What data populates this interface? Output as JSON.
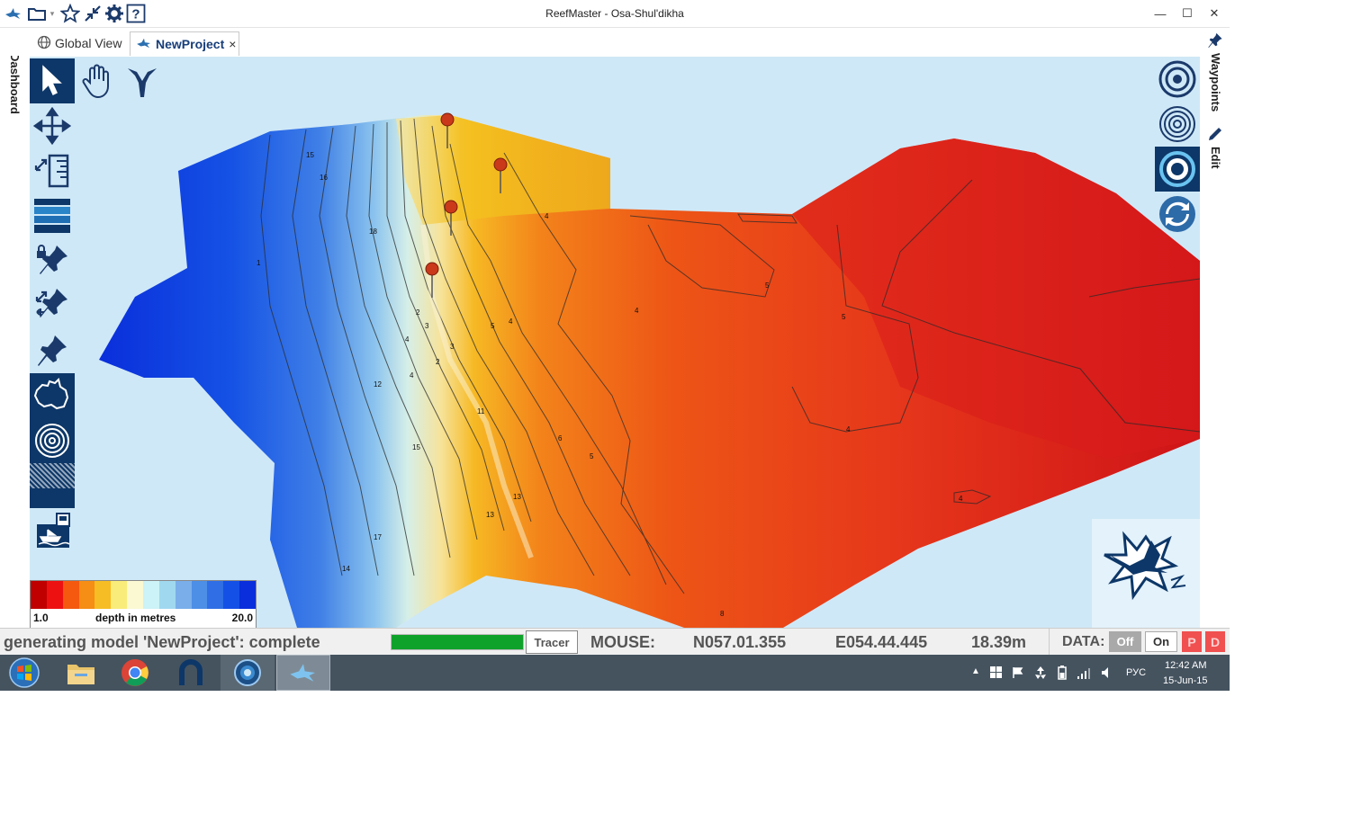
{
  "window": {
    "title": "ReefMaster - Osa-Shul'dikha"
  },
  "tabs": [
    {
      "label": "Global View"
    },
    {
      "label": "NewProject",
      "close": "×"
    }
  ],
  "side_panels": {
    "left": "Dashboard",
    "right_top": "Waypoints",
    "right_bottom": "Edit"
  },
  "legend": {
    "min": "1.0",
    "label": "depth in metres",
    "max": "20.0",
    "colors": [
      "#c00000",
      "#ee1111",
      "#f4590f",
      "#f68d14",
      "#f7bd24",
      "#faec7a",
      "#fbf9d2",
      "#ccf3f7",
      "#a0d8f0",
      "#79aeea",
      "#4d8fe6",
      "#2f6ee5",
      "#1550e6",
      "#0a2edb"
    ]
  },
  "contour_labels": [
    "15",
    "16",
    "18",
    "4",
    "4",
    "5",
    "4",
    "3",
    "2",
    "6",
    "4",
    "5",
    "5",
    "12",
    "17",
    "15",
    "13",
    "13",
    "14",
    "4",
    "1",
    "2",
    "3",
    "4",
    "8",
    "11",
    "5",
    "4"
  ],
  "status": {
    "message": "generating model 'NewProject': complete",
    "progress": 1.0,
    "tracer_button": "Tracer",
    "mouse_label": "MOUSE:",
    "north": "N057.01.355",
    "east": "E054.44.445",
    "depth": "18.39m",
    "data_label": "DATA:",
    "off_button": "Off",
    "on_button": "On",
    "p_button": "P",
    "d_button": "D"
  },
  "taskbar": {
    "language": "РУС",
    "time": "12:42 AM",
    "date": "15-Jun-15"
  }
}
